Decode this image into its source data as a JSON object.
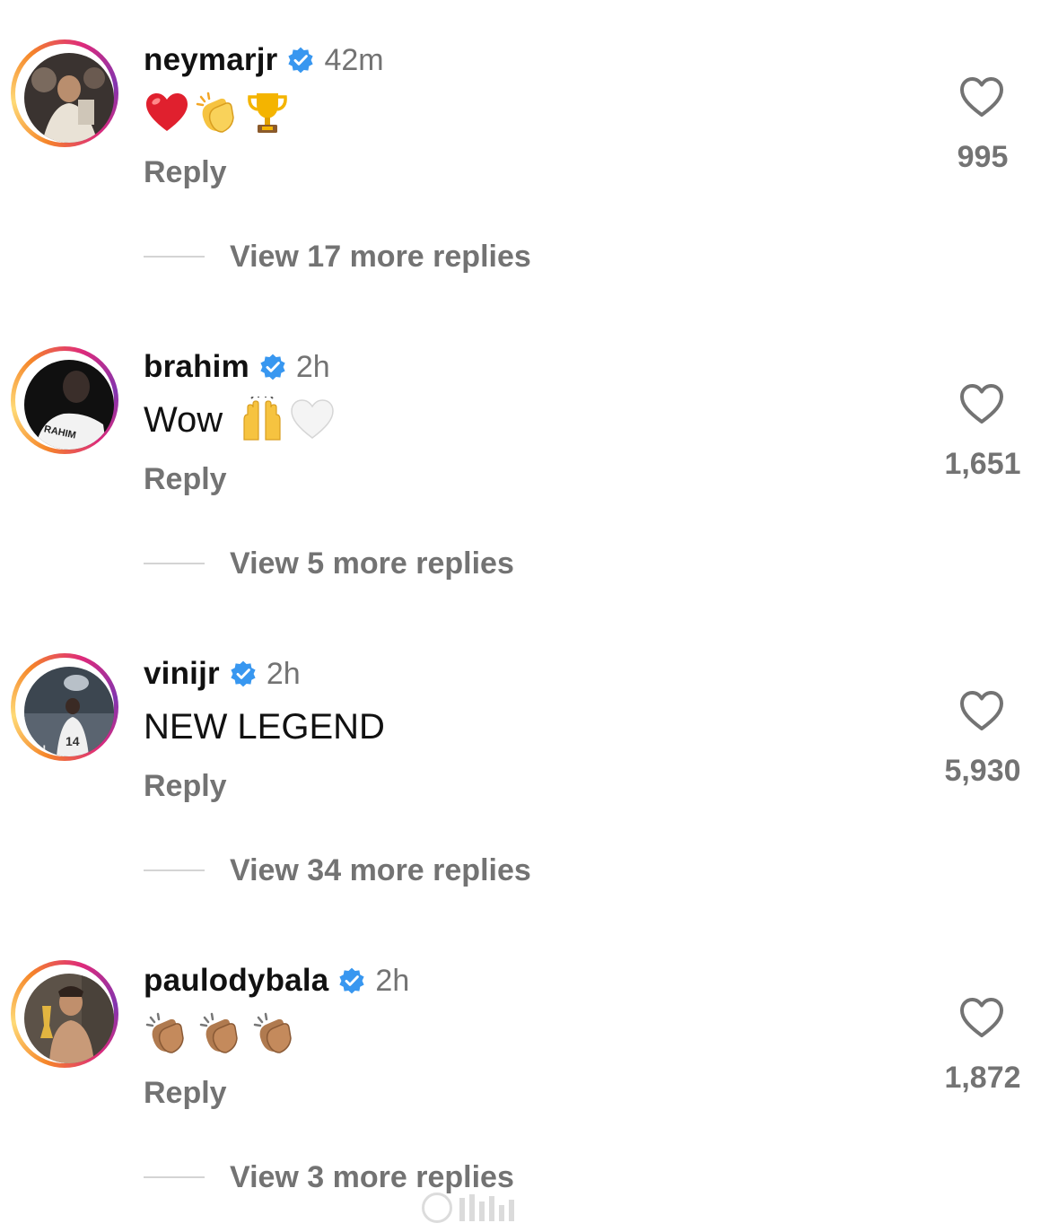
{
  "comments": [
    {
      "username": "neymarjr",
      "verified": true,
      "time": "42m",
      "text": "",
      "emojis": [
        "red-heart",
        "clapping-hands",
        "trophy"
      ],
      "reply_label": "Reply",
      "likes": "995",
      "view_replies": "View 17 more replies"
    },
    {
      "username": "brahim",
      "verified": true,
      "time": "2h",
      "text": "Wow",
      "emojis": [
        "raising-hands",
        "white-heart"
      ],
      "reply_label": "Reply",
      "likes": "1,651",
      "view_replies": "View 5 more replies"
    },
    {
      "username": "vinijr",
      "verified": true,
      "time": "2h",
      "text": "NEW LEGEND",
      "emojis": [],
      "reply_label": "Reply",
      "likes": "5,930",
      "view_replies": "View 34 more replies"
    },
    {
      "username": "paulodybala",
      "verified": true,
      "time": "2h",
      "text": "",
      "emojis": [
        "clapping-hands-medium-skin",
        "clapping-hands-medium-skin",
        "clapping-hands-medium-skin"
      ],
      "reply_label": "Reply",
      "likes": "1,872",
      "view_replies": "View 3 more replies"
    }
  ],
  "colors": {
    "text_primary": "#111111",
    "text_secondary": "#737373",
    "verified_blue": "#3897f0",
    "divider": "#d4d4d4",
    "story_ring_gradient": [
      "#feda77",
      "#f58529",
      "#dd2a7b",
      "#8134af"
    ]
  }
}
